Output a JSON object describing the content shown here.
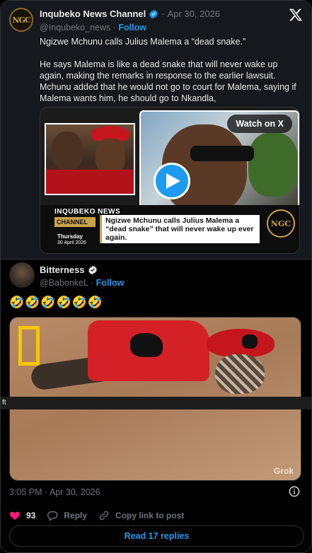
{
  "quoted_post": {
    "author_name": "Inqubeko News Channel",
    "separator": "·",
    "date": "Apr 30, 2026",
    "handle": "@Inqubeko_news",
    "follow_label": "Follow",
    "paragraphs": [
      "Ngizwe Mchunu calls Julius Malema a “dead snake.”",
      "He says Malema is like a dead snake that will never wake up again, making the remarks in response to the earlier lawsuit. Mchunu added that he would not go to court for Malema, saying if Malema wants him, he should go to Nkandla,"
    ],
    "video": {
      "watch_label": "Watch on X",
      "banner_brand": "INQUBEKO NEWS",
      "banner_channel": "CHANNEL",
      "banner_day": "Thursday",
      "banner_date": "30 April 2026",
      "banner_headline": "Ngizwe Mchunu calls Julius Malema a “dead snake” that will never wake up ever again."
    }
  },
  "post": {
    "author_name": "Bitterness",
    "handle": "@BabonkeL",
    "separator": "·",
    "follow_label": "Follow",
    "text": "🤣🤣🤣🤣🤣🤣",
    "image_watermark": "Grok",
    "tooltip_text": "ft",
    "timestamp": "3:05 PM · Apr 30, 2026",
    "like_count": "93",
    "reply_label": "Reply",
    "copy_link_label": "Copy link to post",
    "read_replies_label": "Read 17 replies"
  },
  "colors": {
    "accent": "#1d9bf0",
    "like": "#f91880",
    "background": "#000000",
    "muted": "#71767b"
  },
  "icons": [
    "verified-badge-icon",
    "x-logo-icon",
    "play-icon",
    "info-icon",
    "heart-icon",
    "reply-icon",
    "link-icon"
  ]
}
